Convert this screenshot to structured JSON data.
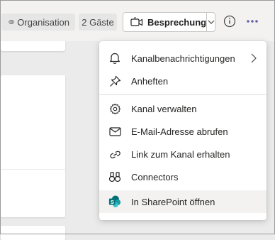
{
  "toolbar": {
    "organisation_label": "Organisation",
    "guests_label": "2 Gäste",
    "meeting_label": "Besprechung"
  },
  "menu": {
    "items": [
      {
        "label": "Kanalbenachrichtigungen",
        "icon": "bell-icon",
        "has_submenu": true
      },
      {
        "label": "Anheften",
        "icon": "pin-icon"
      },
      {
        "label": "Kanal verwalten",
        "icon": "gear-icon"
      },
      {
        "label": "E-Mail-Adresse abrufen",
        "icon": "mail-icon"
      },
      {
        "label": "Link zum Kanal erhalten",
        "icon": "link-icon"
      },
      {
        "label": "Connectors",
        "icon": "connectors-icon"
      },
      {
        "label": "In SharePoint öffnen",
        "icon": "sharepoint-icon"
      }
    ]
  },
  "colors": {
    "accent": "#6264a7",
    "sharepoint": "#038387"
  }
}
